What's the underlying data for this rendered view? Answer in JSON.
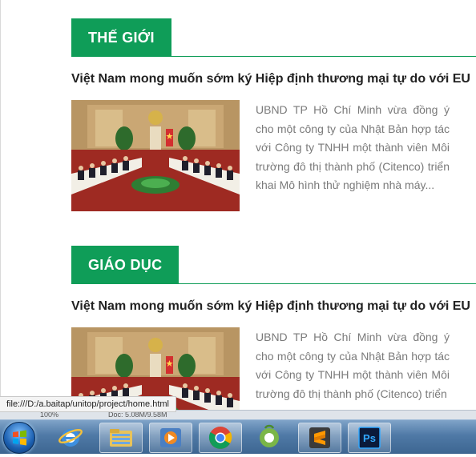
{
  "sections": [
    {
      "tab_label": "THẾ GIỚI",
      "headline": "Việt Nam mong muốn sớm ký Hiệp định thương mại tự do với EU",
      "summary": "UBND TP Hồ Chí Minh vừa đồng ý cho một công ty của Nhật Bản hợp tác với Công ty TNHH một thành viên Môi trường đô thị thành phố (Citenco) triển khai Mô hình thử nghiệm nhà máy..."
    },
    {
      "tab_label": "GIÁO DỤC",
      "headline": "Việt Nam mong muốn sớm ký Hiệp định thương mại tự do với EU",
      "summary": "UBND TP Hồ Chí Minh vừa đồng ý cho một công ty của Nhật Bản hợp tác với Công ty TNHH một thành viên Môi trường đô thị thành phố (Citenco) triển"
    }
  ],
  "status_url": "file:///D:/a.baitap/unitop/project/home.html",
  "background_strip": {
    "left_text": "100%",
    "right_text": "Doc: 5.08M/9.58M"
  },
  "taskbar": {
    "buttons": [
      {
        "name": "windows-start-icon"
      },
      {
        "name": "internet-explorer-icon"
      },
      {
        "name": "file-explorer-icon"
      },
      {
        "name": "media-player-icon"
      },
      {
        "name": "chrome-icon"
      },
      {
        "name": "coc-coc-browser-icon"
      },
      {
        "name": "sublime-text-icon"
      },
      {
        "name": "photoshop-icon",
        "label": "Ps"
      }
    ]
  },
  "colors": {
    "accent_green": "#0f9d58",
    "headline": "#222222",
    "summary": "#7a7a7a"
  }
}
